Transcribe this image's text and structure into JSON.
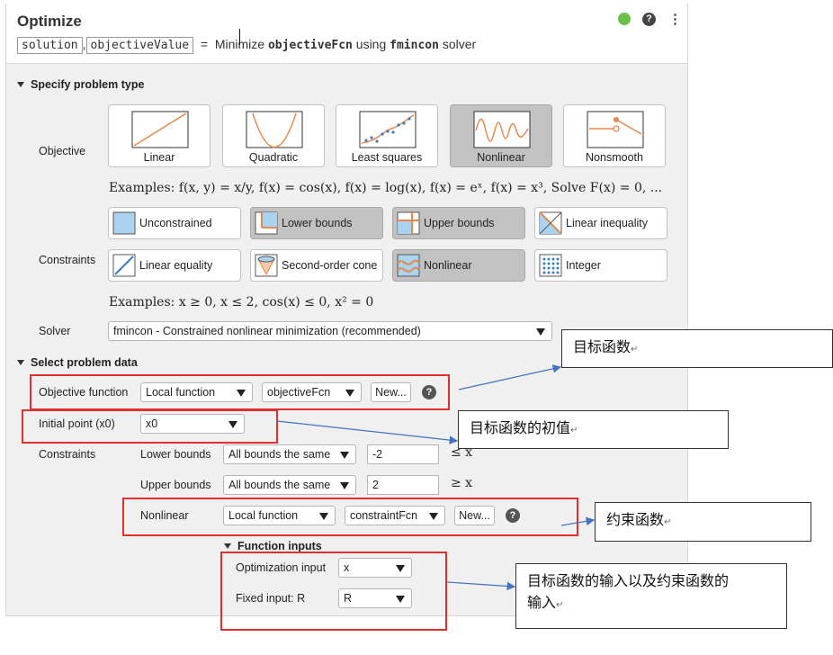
{
  "header": {
    "title": "Optimize",
    "output1": "solution",
    "comma": ",",
    "output2": "objectiveValue",
    "equals": "=",
    "text1": "Minimize",
    "fcn": "objectiveFcn",
    "text2": "using",
    "solver": "fmincon",
    "text3": "solver"
  },
  "problem_type": {
    "section_title": "Specify problem type",
    "objective_label": "Objective",
    "objectives": [
      {
        "label": "Linear",
        "icon": "linear-plot-icon",
        "selected": false
      },
      {
        "label": "Quadratic",
        "icon": "quadratic-plot-icon",
        "selected": false
      },
      {
        "label": "Least squares",
        "icon": "least-squares-plot-icon",
        "selected": false
      },
      {
        "label": "Nonlinear",
        "icon": "nonlinear-plot-icon",
        "selected": true
      },
      {
        "label": "Nonsmooth",
        "icon": "nonsmooth-plot-icon",
        "selected": false
      }
    ],
    "objective_examples": "Examples: f(x, y) = x/y, f(x) = cos(x), f(x) = log(x), f(x) = eˣ, f(x) = x³, Solve F(x) = 0, ...",
    "constraints_label": "Constraints",
    "constraints": [
      {
        "label": "Unconstrained",
        "icon": "unconstrained-icon",
        "selected": false
      },
      {
        "label": "Lower bounds",
        "icon": "lower-bounds-icon",
        "selected": true
      },
      {
        "label": "Upper bounds",
        "icon": "upper-bounds-icon",
        "selected": true
      },
      {
        "label": "Linear inequality",
        "icon": "linear-inequality-icon",
        "selected": false
      },
      {
        "label": "Linear equality",
        "icon": "linear-equality-icon",
        "selected": false
      },
      {
        "label": "Second-order cone",
        "icon": "second-order-cone-icon",
        "selected": false
      },
      {
        "label": "Nonlinear",
        "icon": "nonlinear-constraint-icon",
        "selected": true
      },
      {
        "label": "Integer",
        "icon": "integer-icon",
        "selected": false
      }
    ],
    "constraint_examples": "Examples: x ≥ 0, x ≤ 2, cos(x) ≤ 0, x² = 0",
    "solver_label": "Solver",
    "solver_value": "fmincon - Constrained nonlinear minimization (recommended)"
  },
  "problem_data": {
    "section_title": "Select problem data",
    "objective_function_label": "Objective function",
    "objective_source": "Local function",
    "objective_name": "objectiveFcn",
    "new_label": "New...",
    "initial_point_label": "Initial point (x0)",
    "initial_point_value": "x0",
    "constraints_label": "Constraints",
    "lower_bounds_label": "Lower bounds",
    "lower_bounds_mode": "All bounds the same",
    "lower_bounds_value": "-2",
    "lower_rel": "≤ x",
    "upper_bounds_label": "Upper bounds",
    "upper_bounds_mode": "All bounds the same",
    "upper_bounds_value": "2",
    "upper_rel": "≥ x",
    "nonlinear_label": "Nonlinear",
    "nonlinear_source": "Local function",
    "nonlinear_name": "constraintFcn",
    "function_inputs_title": "Function inputs",
    "optimization_input_label": "Optimization input",
    "optimization_input_value": "x",
    "fixed_input_label": "Fixed input: R",
    "fixed_input_value": "R"
  },
  "annotations": [
    {
      "text": "目标函数",
      "mark": "↵"
    },
    {
      "text": "目标函数的初值",
      "mark": "↵"
    },
    {
      "text": "约束函数",
      "mark": "↵"
    },
    {
      "text": "目标函数的输入以及约束函数的",
      "text2": "输入",
      "mark": "↵"
    }
  ],
  "colors": {
    "selected_tile": "#c2c2c2",
    "panel_bg": "#f0f0f0",
    "status_ok": "#6cc04a",
    "annotation_red": "#e0302e",
    "arrow_blue": "#4472c4",
    "plot_orange": "#e8884a"
  }
}
